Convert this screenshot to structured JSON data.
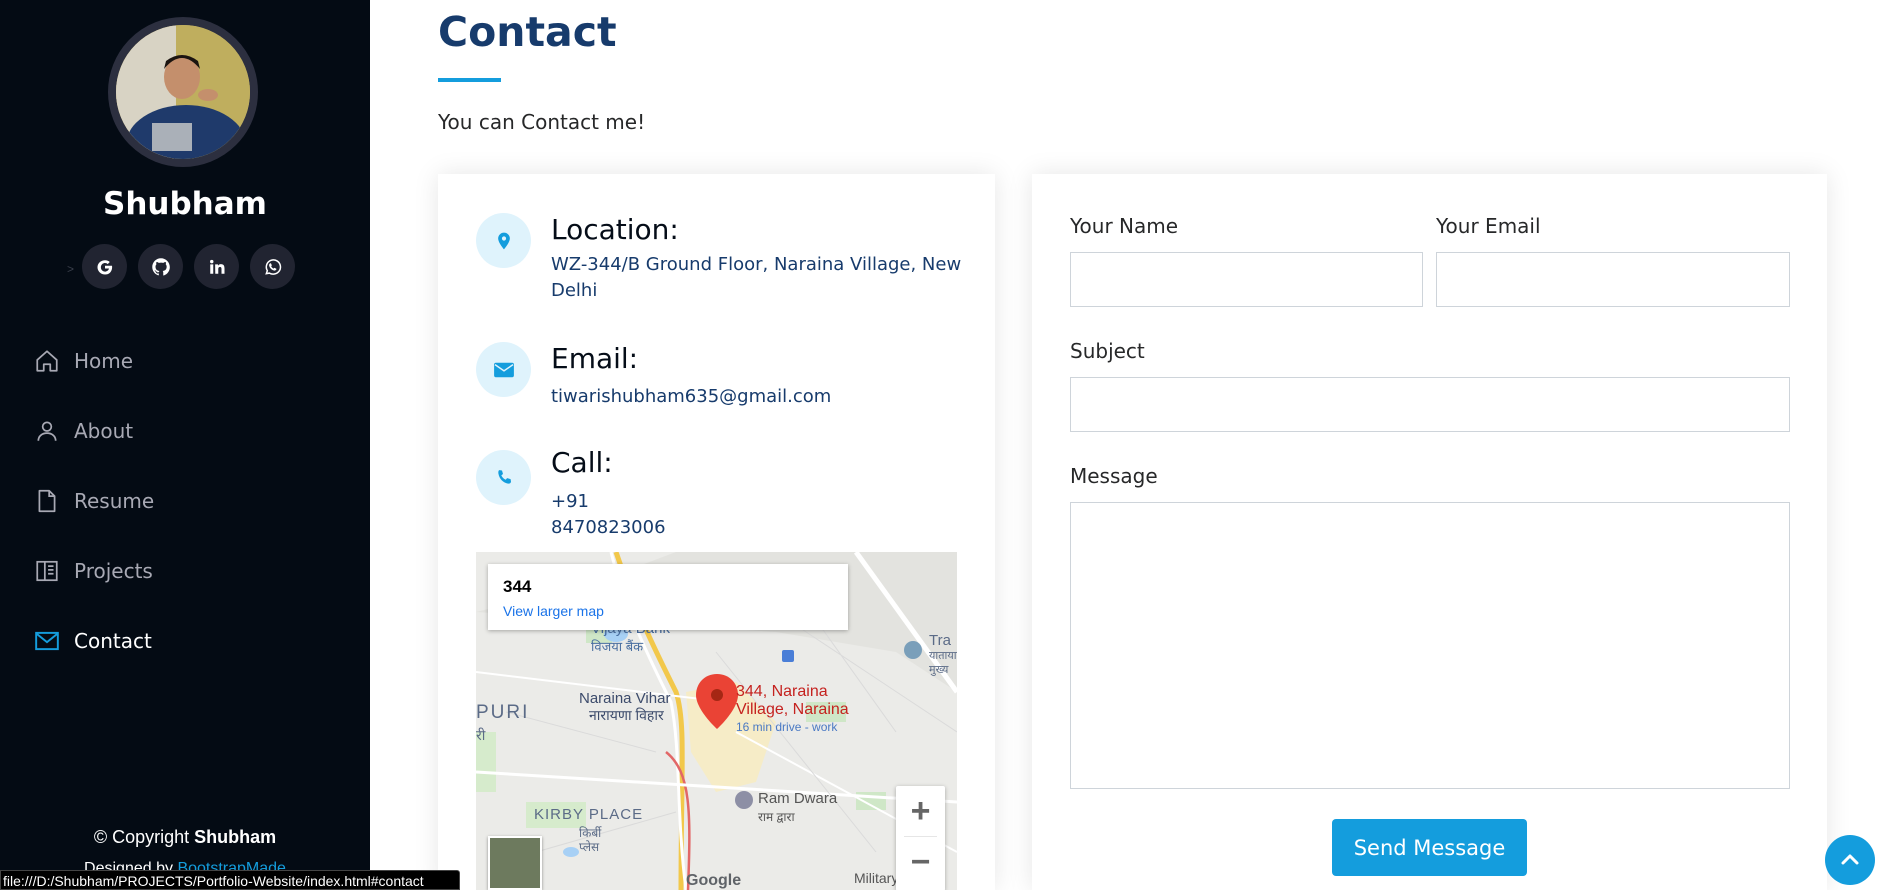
{
  "sidebar": {
    "profile_name": "Shubham",
    "social_icons": [
      "google-icon",
      "github-icon",
      "linkedin-icon",
      "whatsapp-icon"
    ],
    "nav": [
      {
        "label": "Home",
        "icon": "home-icon",
        "active": false
      },
      {
        "label": "About",
        "icon": "person-icon",
        "active": false
      },
      {
        "label": "Resume",
        "icon": "file-icon",
        "active": false
      },
      {
        "label": "Projects",
        "icon": "book-icon",
        "active": false
      },
      {
        "label": "Contact",
        "icon": "envelope-icon",
        "active": true
      }
    ],
    "footer": {
      "copyright_prefix": "© Copyright ",
      "copyright_name": "Shubham",
      "designed_prefix": "Designed by ",
      "designed_link": "BootstrapMade"
    }
  },
  "status_bar": "file:///D:/Shubham/PROJECTS/Portfolio-Website/index.html#contact",
  "main": {
    "title": "Contact",
    "description": "You can Contact me!",
    "info": {
      "location_label": "Location:",
      "location_value": "WZ-344/B Ground Floor, Naraina Village, New Delhi",
      "email_label": "Email:",
      "email_value": "tiwarishubham635@gmail.com",
      "call_label": "Call:",
      "call_value": "+91 8470823006"
    },
    "map": {
      "card_title": "344",
      "card_link": "View larger map",
      "zoom_in": "+",
      "zoom_out": "−",
      "labels": {
        "bank_en": "Vijaya Bank",
        "bank_hi": "विजया बैंक",
        "vihar_en": "Naraina Vihar",
        "vihar_hi": "नारायणा विहार",
        "pin_line1": "344, Naraina",
        "pin_line2": "Village, Naraina",
        "pin_drive": "16 min drive - work",
        "puri": "PURI",
        "puri_hi": "री",
        "kirby_en": "KIRBY PLACE",
        "kirby_hi1": "किर्बी",
        "kirby_hi2": "प्लेस",
        "ramdwara_en": "Ram Dwara",
        "ramdwara_hi": "राम द्वारा",
        "transport_1": "Tra",
        "transport_2": "यातायात",
        "transport_3": "मुख्य",
        "military": "Military Area,",
        "google": "Google"
      }
    },
    "form": {
      "name_label": "Your Name",
      "email_label": "Your Email",
      "subject_label": "Subject",
      "message_label": "Message",
      "name_value": "",
      "email_value": "",
      "subject_value": "",
      "message_value": "",
      "submit_label": "Send Message"
    }
  },
  "colors": {
    "sidebar_bg": "#040b14",
    "accent": "#149ddd",
    "title": "#173b6c"
  }
}
